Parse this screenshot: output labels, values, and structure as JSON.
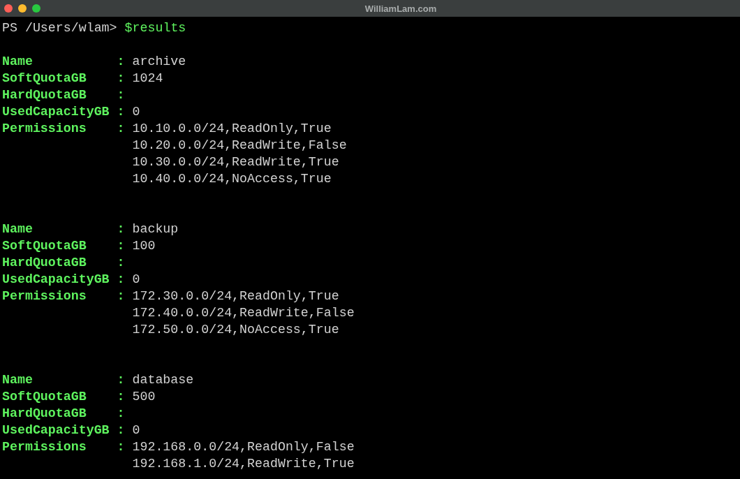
{
  "window": {
    "title": "WilliamLam.com"
  },
  "prompt": {
    "text": "PS /Users/wlam>",
    "command": "$results"
  },
  "records": [
    {
      "fields": [
        {
          "label": "Name",
          "separator": ":",
          "values": [
            "archive"
          ]
        },
        {
          "label": "SoftQuotaGB",
          "separator": ":",
          "values": [
            "1024"
          ]
        },
        {
          "label": "HardQuotaGB",
          "separator": ":"
        },
        {
          "label": "UsedCapacityGB",
          "separator": ":",
          "values": [
            "0"
          ]
        },
        {
          "label": "Permissions",
          "separator": ":",
          "values": [
            "10.10.0.0/24,ReadOnly,True",
            "10.20.0.0/24,ReadWrite,False",
            "10.30.0.0/24,ReadWrite,True",
            "10.40.0.0/24,NoAccess,True"
          ]
        }
      ]
    },
    {
      "fields": [
        {
          "label": "Name",
          "separator": ":",
          "values": [
            "backup"
          ]
        },
        {
          "label": "SoftQuotaGB",
          "separator": ":",
          "values": [
            "100"
          ]
        },
        {
          "label": "HardQuotaGB",
          "separator": ":"
        },
        {
          "label": "UsedCapacityGB",
          "separator": ":",
          "values": [
            "0"
          ]
        },
        {
          "label": "Permissions",
          "separator": ":",
          "values": [
            "172.30.0.0/24,ReadOnly,True",
            "172.40.0.0/24,ReadWrite,False",
            "172.50.0.0/24,NoAccess,True"
          ]
        }
      ]
    },
    {
      "fields": [
        {
          "label": "Name",
          "separator": ":",
          "values": [
            "database"
          ]
        },
        {
          "label": "SoftQuotaGB",
          "separator": ":",
          "values": [
            "500"
          ]
        },
        {
          "label": "HardQuotaGB",
          "separator": ":"
        },
        {
          "label": "UsedCapacityGB",
          "separator": ":",
          "values": [
            "0"
          ]
        },
        {
          "label": "Permissions",
          "separator": ":",
          "values": [
            "192.168.0.0/24,ReadOnly,False",
            "192.168.1.0/24,ReadWrite,True"
          ]
        }
      ]
    }
  ]
}
